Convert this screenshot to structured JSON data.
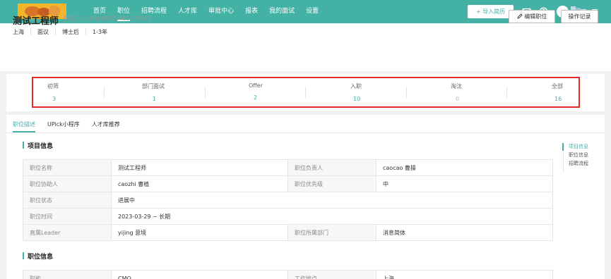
{
  "nav": {
    "items": [
      {
        "label": "首页",
        "active": false
      },
      {
        "label": "职位",
        "active": true
      },
      {
        "label": "招聘流程",
        "active": false
      },
      {
        "label": "人才库",
        "active": false
      },
      {
        "label": "审批中心",
        "active": false
      },
      {
        "label": "报表",
        "active": false
      },
      {
        "label": "我的面试",
        "active": false
      },
      {
        "label": "设置",
        "active": false
      }
    ],
    "import_button": "+ 导入简历",
    "icons": [
      "mail-icon",
      "help-icon",
      "user-avatar",
      "chevron-down-icon"
    ]
  },
  "job": {
    "title": "测试工程师",
    "id_label": "职位ID：",
    "id_value": "164109522485379072",
    "tags": [
      "上海",
      "面议",
      "博士后",
      "1-3年"
    ],
    "edit_button": "编辑职位",
    "log_button": "操作记录"
  },
  "stats": [
    {
      "label": "初筛",
      "value": "3"
    },
    {
      "label": "部门面试",
      "value": "1"
    },
    {
      "label": "Offer",
      "value": "2"
    },
    {
      "label": "入职",
      "value": "10"
    },
    {
      "label": "淘汰",
      "value": "0"
    },
    {
      "label": "全部",
      "value": "16"
    }
  ],
  "tabs": [
    {
      "label": "职位描述",
      "active": true
    },
    {
      "label": "UPick小程序",
      "active": false
    },
    {
      "label": "人才库推荐",
      "active": false
    }
  ],
  "project_section": {
    "title": "项目信息",
    "rows": [
      [
        {
          "k": "职位名称",
          "v": "测试工程师"
        },
        {
          "k": "职位负责人",
          "v": "caocao 曹操"
        }
      ],
      [
        {
          "k": "职位协助人",
          "v": "caozhi 曹植"
        },
        {
          "k": "职位优先级",
          "v": "中"
        }
      ],
      [
        {
          "k": "职位状态",
          "v": "进展中"
        }
      ],
      [
        {
          "k": "职位时间",
          "v": "2023-03-29 ~ 长期"
        }
      ],
      [
        {
          "k": "直属Leader",
          "v": "yijing 意境"
        },
        {
          "k": "职位所属部门",
          "v": "消息简体"
        }
      ]
    ]
  },
  "job_section": {
    "title": "职位信息",
    "rows": [
      [
        {
          "k": "职能",
          "v": "CMO"
        },
        {
          "k": "工作地点",
          "v": "上海"
        }
      ]
    ]
  },
  "anchors": [
    {
      "label": "项目信息",
      "active": true
    },
    {
      "label": "职位信息",
      "active": false
    },
    {
      "label": "招聘流程",
      "active": false
    }
  ],
  "colors": {
    "brand": "#43b1a4",
    "highlight_frame": "#e02b2b"
  }
}
